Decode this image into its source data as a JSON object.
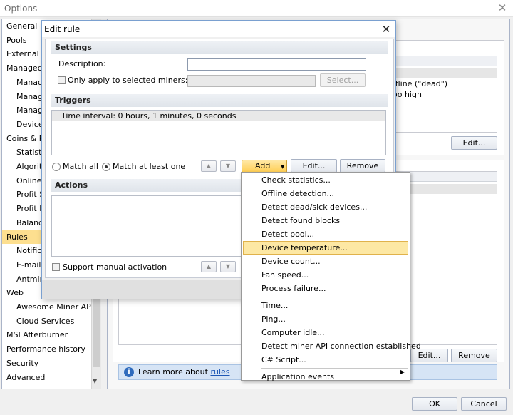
{
  "options_window": {
    "title": "Options",
    "close_glyph": "✕",
    "ok_label": "OK",
    "cancel_label": "Cancel"
  },
  "nav": {
    "items": [
      {
        "label": "General",
        "indent": 0
      },
      {
        "label": "Pools",
        "indent": 0
      },
      {
        "label": "External M",
        "indent": 0
      },
      {
        "label": "Managed H",
        "indent": 0
      },
      {
        "label": "Manag",
        "indent": 1
      },
      {
        "label": "Manag",
        "indent": 1
      },
      {
        "label": "Manag",
        "indent": 1
      },
      {
        "label": "Device",
        "indent": 1
      },
      {
        "label": "Coins & Pr",
        "indent": 0
      },
      {
        "label": "Statisti",
        "indent": 1
      },
      {
        "label": "Algorith",
        "indent": 1
      },
      {
        "label": "Online s",
        "indent": 1
      },
      {
        "label": "Profit Sw",
        "indent": 1
      },
      {
        "label": "Profit Pr",
        "indent": 1
      },
      {
        "label": "Balance",
        "indent": 1
      },
      {
        "label": "Rules",
        "indent": 0,
        "selected": true
      },
      {
        "label": "Notifica",
        "indent": 1
      },
      {
        "label": "E-mail &",
        "indent": 1
      },
      {
        "label": "Antmine",
        "indent": 1
      },
      {
        "label": "Web",
        "indent": 0
      },
      {
        "label": "Awesome Miner API",
        "indent": 1
      },
      {
        "label": "Cloud Services",
        "indent": 1
      },
      {
        "label": "MSI Afterburner",
        "indent": 0
      },
      {
        "label": "Performance history",
        "indent": 0
      },
      {
        "label": "Security",
        "indent": 0
      },
      {
        "label": "Advanced",
        "indent": 0
      }
    ]
  },
  "background": {
    "text1": "ffline (\"dead\")",
    "text2": "oo high",
    "edit_label": "Edit...",
    "edit_label2": "Edit...",
    "remove_label": "Remove",
    "info_text": "Learn more about ",
    "info_link": "rules",
    "info_icon": "i"
  },
  "dialog": {
    "title": "Edit rule",
    "close_glyph": "✕",
    "settings_header": "Settings",
    "description_label": "Description:",
    "description_value": "",
    "only_apply_label": "Only apply to selected miners:",
    "select_button": "Select...",
    "triggers_header": "Triggers",
    "triggers": [
      "Time interval: 0 hours, 1 minutes, 0 seconds"
    ],
    "match_all_label": "Match all",
    "match_at_least_one_label": "Match at least one",
    "match_selected": "at_least_one",
    "add_label": "Add",
    "edit_label": "Edit...",
    "remove_label": "Remove",
    "actions_header": "Actions",
    "support_manual_label": "Support manual activation"
  },
  "add_menu": {
    "group1": [
      "Check statistics...",
      "Offline detection...",
      "Detect dead/sick devices...",
      "Detect found blocks",
      "Detect pool...",
      "Device temperature...",
      "Device count...",
      "Fan speed...",
      "Process failure..."
    ],
    "group2": [
      "Time...",
      "Ping...",
      "Computer idle...",
      "Detect miner API connection established",
      "C# Script..."
    ],
    "group3": [
      "Application events"
    ],
    "highlighted": "Device temperature..."
  }
}
